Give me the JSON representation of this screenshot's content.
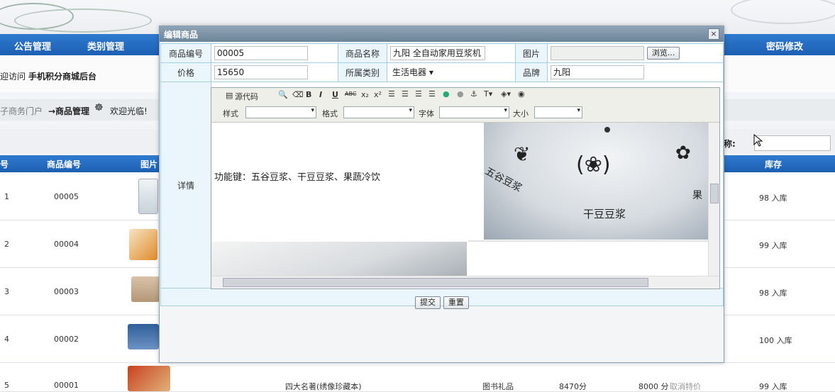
{
  "nav": {
    "items": [
      "公告管理",
      "类别管理",
      "密码修改"
    ]
  },
  "welcome": {
    "prefix": "迎访问",
    "title": "手机积分商城后台"
  },
  "breadcrumb": {
    "portal": "子商务门户",
    "current": "→商品管理",
    "greeting": "欢迎光临!"
  },
  "search": {
    "label": "称:"
  },
  "table": {
    "headers": [
      "号",
      "商品编号",
      "图片",
      "库存"
    ],
    "rows": [
      {
        "index": "1",
        "code": "00005",
        "stock": "98 入库"
      },
      {
        "index": "2",
        "code": "00004",
        "stock": "99 入库"
      },
      {
        "index": "3",
        "code": "00003",
        "stock": "98 入库"
      },
      {
        "index": "4",
        "code": "00002",
        "stock": "100 入库"
      },
      {
        "index": "5",
        "code": "00001",
        "name": "四大名著(绣像珍藏本)",
        "category": "图书礼品",
        "points": "8470分",
        "special": "8000 分",
        "cancel": "取消特价",
        "stock": "99 入库"
      }
    ]
  },
  "modal": {
    "title": "编辑商品",
    "close": "×",
    "fields": {
      "code_label": "商品编号",
      "code": "00005",
      "name_label": "商品名称",
      "name": "九阳 全自动家用豆浆机",
      "image_label": "图片",
      "browse": "浏览...",
      "price_label": "价格",
      "price": "15650",
      "category_label": "所属类别",
      "category": "生活电器",
      "brand_label": "品牌",
      "brand": "九阳",
      "detail_label": "详情"
    },
    "editor": {
      "source": "源代码",
      "style_label": "样式",
      "format_label": "格式",
      "font_label": "字体",
      "size_label": "大小",
      "content": "功能键：五谷豆浆、干豆豆浆、果蔬冷饮",
      "image_text_1": "五谷豆浆",
      "image_text_2": "干豆豆浆",
      "image_text_3": "果"
    },
    "submit": "提交",
    "reset": "重置"
  }
}
